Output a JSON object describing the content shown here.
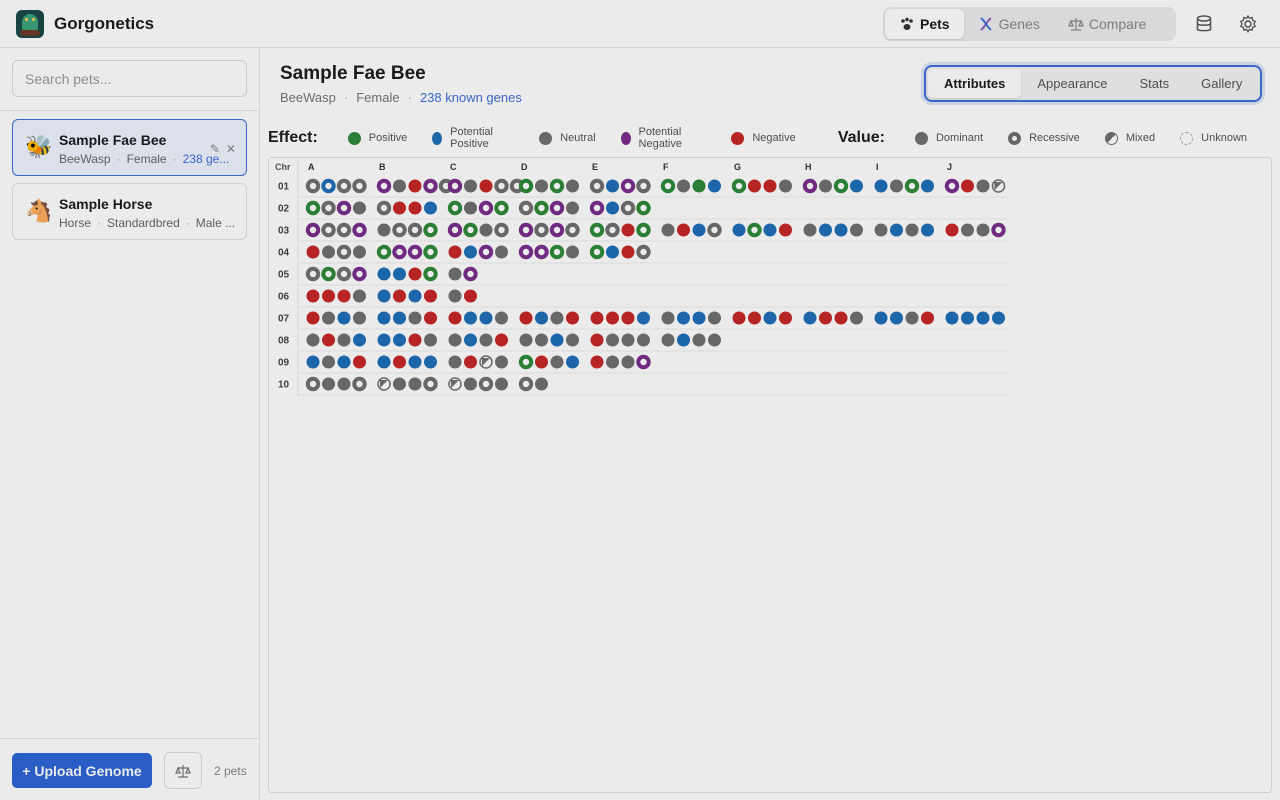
{
  "app": {
    "title": "Gorgonetics"
  },
  "nav": {
    "tabs": [
      {
        "label": "Pets",
        "icon": "paw-icon",
        "active": true
      },
      {
        "label": "Genes",
        "icon": "dna-icon",
        "active": false
      },
      {
        "label": "Compare",
        "icon": "scale-icon",
        "active": false
      }
    ]
  },
  "sidebar": {
    "search_placeholder": "Search pets...",
    "pets": [
      {
        "name": "Sample Fae Bee",
        "emoji": "🐝",
        "species": "BeeWasp",
        "gender": "Female",
        "genes": "238 ge...",
        "selected": true
      },
      {
        "name": "Sample Horse",
        "emoji": "🐴",
        "species": "Horse",
        "breed": "Standardbred",
        "gender": "Male ...",
        "selected": false
      }
    ],
    "upload_label": "+ Upload Genome",
    "pet_count": "2 pets"
  },
  "main": {
    "title": "Sample Fae Bee",
    "species": "BeeWasp",
    "gender": "Female",
    "known_genes": "238 known genes",
    "view_tabs": [
      "Attributes",
      "Appearance",
      "Stats",
      "Gallery"
    ],
    "active_view": "Attributes"
  },
  "legend": {
    "effect_title": "Effect:",
    "effects": [
      {
        "label": "Positive",
        "color": "#2f8a3a"
      },
      {
        "label": "Potential Positive",
        "color": "#1f6fb8"
      },
      {
        "label": "Neutral",
        "color": "#707070"
      },
      {
        "label": "Potential Negative",
        "color": "#7b2e8c"
      },
      {
        "label": "Negative",
        "color": "#c62828"
      }
    ],
    "value_title": "Value:",
    "values": [
      {
        "label": "Dominant",
        "kind": "dominant"
      },
      {
        "label": "Recessive",
        "kind": "recessive"
      },
      {
        "label": "Mixed",
        "kind": "mixed"
      },
      {
        "label": "Unknown",
        "kind": "unknown"
      }
    ]
  },
  "grid": {
    "header_label": "Chr",
    "columns": [
      "A",
      "B",
      "C",
      "D",
      "E",
      "F",
      "G",
      "H",
      "I",
      "J"
    ],
    "rows": [
      {
        "chr": "01",
        "genes": "NrBrNrNr RrNRRrNr RrNRNrNr GrNGrN NrBRrNr GrNGB GrRRN RrNGrB BNGrB RrRNMx"
      },
      {
        "chr": "02",
        "genes": "GrNrRrN NrRRB GrNRrGr NrGrRrN RrBNrGr"
      },
      {
        "chr": "03",
        "genes": "RrNrNrRr NNrNrGr RrGrNNr RrNrRrNr GrNrRGr NRBNr BGrBR NBBN NBNB RNNRr"
      },
      {
        "chr": "04",
        "genes": "RNNrN GrRrRrGr RBRrN RrRrGrN GrBRNr"
      },
      {
        "chr": "05",
        "genes": "NrGrNrRr BBRGr NRr"
      },
      {
        "chr": "06",
        "genes": "RRRN BRBR NR"
      },
      {
        "chr": "07",
        "genes": "RNBN BBNR RBBN RBNR RRRB NBBN RRBR BRRN BBNR BBBB"
      },
      {
        "chr": "08",
        "genes": "NRNB BBRN NBNR NNBN RNNN NBNN"
      },
      {
        "chr": "09",
        "genes": "BNBR BRBB NRMxN GrRNB RNNRr"
      },
      {
        "chr": "10",
        "genes": "NrNNNr MxNNNr MxNNrN NrN"
      }
    ]
  }
}
